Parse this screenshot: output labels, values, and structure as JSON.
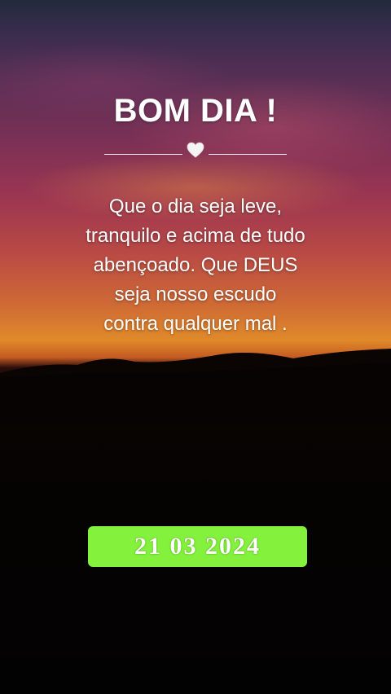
{
  "greeting": {
    "title": "BOM DIA !",
    "divider_icon": "white-heart-icon",
    "message_lines": [
      "Que o dia seja leve,",
      "tranquilo e acima de tudo",
      "abençoado. Que DEUS",
      "seja nosso escudo",
      "contra qualquer mal ."
    ]
  },
  "date_badge": {
    "text": "21 03 2024",
    "background_color": "#84f23c",
    "text_color": "#ffffff"
  },
  "colors": {
    "sky_top": "#222a3d",
    "sky_mid": "#9a3552",
    "horizon_glow": "#e08a2a",
    "ground": "#050302"
  }
}
